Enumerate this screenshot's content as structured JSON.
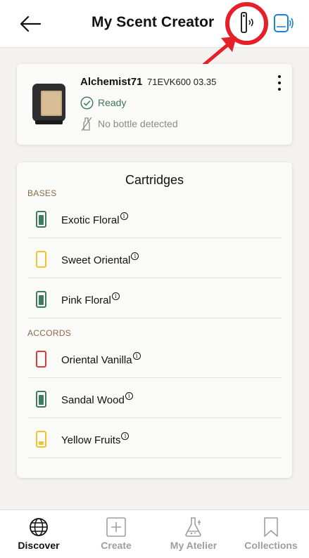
{
  "header": {
    "title": "My Scent Creator",
    "back_icon": "back-arrow-icon",
    "remote_icon": "remote-connect-icon",
    "speaker_icon": "bluetooth-device-icon",
    "highlight_color": "#e5202a"
  },
  "device": {
    "name": "Alchemist71",
    "serial": "71EVK600  03.35",
    "status": "Ready",
    "bottle_status": "No bottle detected",
    "status_color": "#3c7a5a"
  },
  "cartridges": {
    "title": "Cartridges",
    "bases_label": "BASES",
    "accords_label": "ACCORDS",
    "bases": [
      {
        "label": "Exotic Floral",
        "color": "#3f7a5c",
        "level": 0.9
      },
      {
        "label": "Sweet Oriental",
        "color": "#f2c230",
        "level": 0.0
      },
      {
        "label": "Pink Floral",
        "color": "#3f7a5c",
        "level": 0.9
      }
    ],
    "accords": [
      {
        "label": "Oriental Vanilla",
        "color": "#d93a3a",
        "level": 0.0
      },
      {
        "label": "Sandal Wood",
        "color": "#3f7a5c",
        "level": 0.9
      },
      {
        "label": "Yellow Fruits",
        "color": "#f2c230",
        "level": 0.3
      }
    ],
    "info_glyph": "i"
  },
  "tabs": [
    {
      "label": "Discover",
      "icon": "globe-icon",
      "active": true
    },
    {
      "label": "Create",
      "icon": "plus-square-icon",
      "active": false
    },
    {
      "label": "My Atelier",
      "icon": "flask-icon",
      "active": false
    },
    {
      "label": "Collections",
      "icon": "bookmark-icon",
      "active": false
    }
  ]
}
